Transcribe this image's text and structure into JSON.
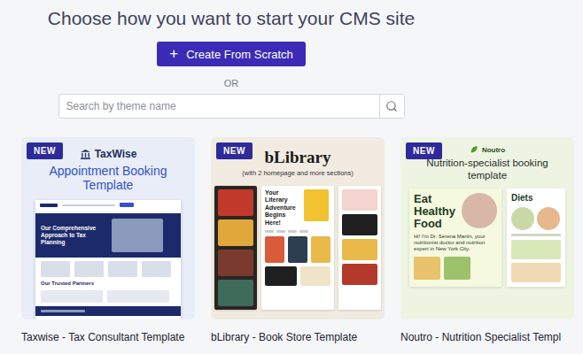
{
  "page": {
    "title": "Choose how you want to start your CMS site"
  },
  "create_button": {
    "icon": "+",
    "label": "Create From Scratch"
  },
  "divider": "OR",
  "search": {
    "placeholder": "Search by theme name"
  },
  "templates": [
    {
      "name": "Taxwise - Tax Consultant Template",
      "badge": "NEW",
      "kind": "taxwise",
      "preview": {
        "brand": "TaxWise",
        "headline": "Appointment Booking Template",
        "hero": "Our Comprehensive Approach to Tax Planning",
        "section": "Our Trusted Partners"
      }
    },
    {
      "name": "bLibrary - Book Store Template",
      "badge": "NEW",
      "kind": "blibrary",
      "preview": {
        "brand": "bLibrary",
        "subtitle": "(with 2 homepage and more sections)",
        "hero": "Your Literary Adventure Begins Here!"
      }
    },
    {
      "name": "Noutro - Nutrition Specialist Templ",
      "badge": "NEW",
      "kind": "noutro",
      "preview": {
        "brand": "Noutro",
        "headline": "Nutrition-specialist booking template",
        "hero": "Eat Healthy Food",
        "side": "Diets",
        "intro": "Hi! I'm Dr. Serena Martin, your nutritionist doctor and nutrition expert in New York City."
      }
    }
  ]
}
